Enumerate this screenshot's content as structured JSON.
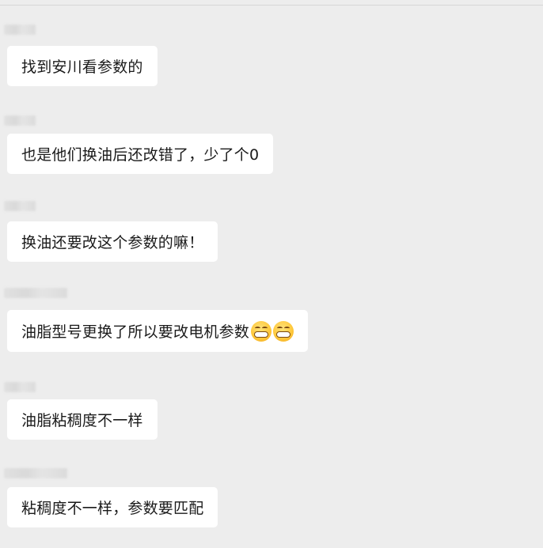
{
  "chat": {
    "messages": [
      {
        "text": "找到安川看参数的",
        "emoji_count": 0
      },
      {
        "text": "也是他们换油后还改错了，少了个0",
        "emoji_count": 0
      },
      {
        "text": "换油还要改这个参数的嘛！",
        "emoji_count": 0
      },
      {
        "text": "油脂型号更换了所以要改电机参数",
        "emoji_count": 2
      },
      {
        "text": "油脂粘稠度不一样",
        "emoji_count": 0
      },
      {
        "text": "粘稠度不一样，参数要匹配",
        "emoji_count": 0
      }
    ],
    "emoji_icon": "grinning-face-icon",
    "colors": {
      "background": "#ededed",
      "bubble": "#ffffff",
      "text": "#1a1a1a"
    }
  }
}
